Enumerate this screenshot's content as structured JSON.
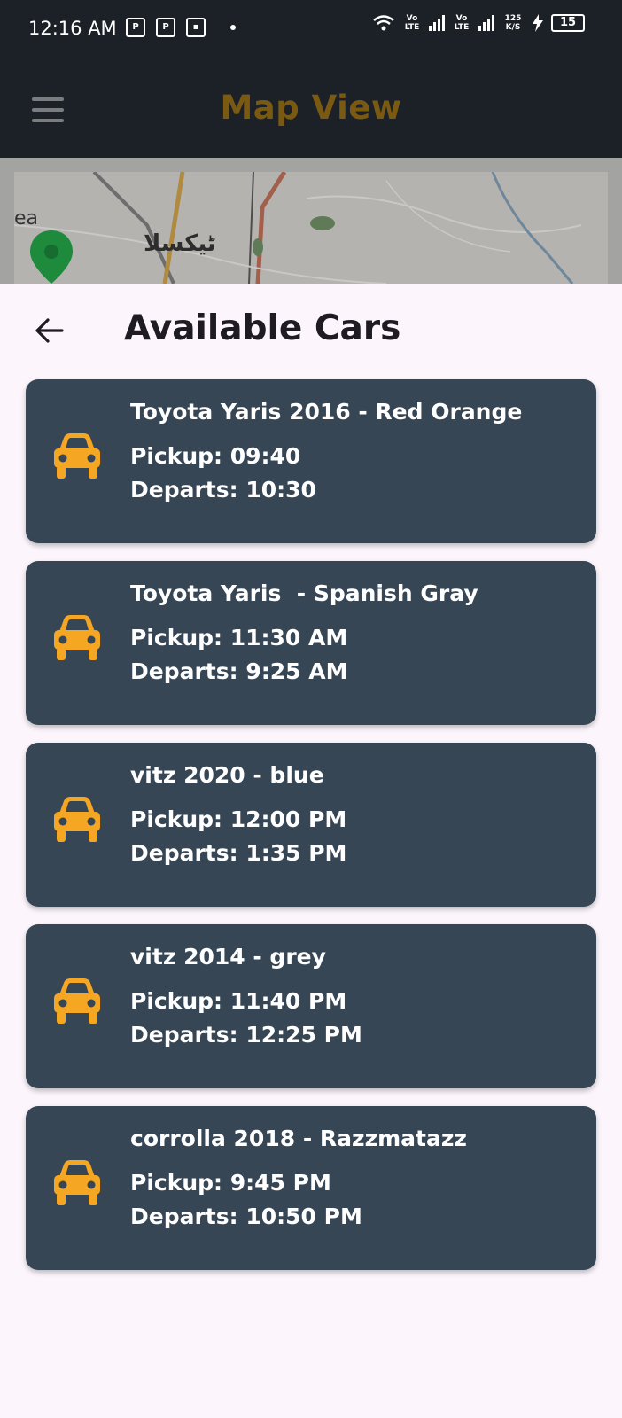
{
  "status_bar": {
    "time": "12:16 AM",
    "vo_lte_1": "Vo LTE",
    "vo_lte_2": "Vo LTE",
    "speed": "125 K/S",
    "battery": "15"
  },
  "app_bar": {
    "title": "Map View",
    "menu_icon": "hamburger-icon"
  },
  "map": {
    "label_urdu": "ٹیکسلا",
    "label_fragment": "ea"
  },
  "sheet": {
    "title": "Available Cars",
    "back_icon": "back-arrow-icon"
  },
  "colors": {
    "accent": "#f5a623",
    "card": "#374655",
    "app_bar": "#1c2127",
    "title_brown": "#7a5a12"
  },
  "cars": [
    {
      "name": "Toyota Yaris 2016 - Red Orange",
      "pickup": "Pickup: 09:40",
      "departs": "Departs: 10:30"
    },
    {
      "name": "Toyota Yaris  - Spanish Gray",
      "pickup": "Pickup: 11:30 AM",
      "departs": "Departs: 9:25 AM"
    },
    {
      "name": "vitz 2020 - blue",
      "pickup": "Pickup: 12:00 PM",
      "departs": "Departs: 1:35 PM"
    },
    {
      "name": "vitz 2014 - grey",
      "pickup": "Pickup: 11:40 PM",
      "departs": "Departs: 12:25 PM"
    },
    {
      "name": "corrolla 2018 - Razzmatazz",
      "pickup": "Pickup: 9:45 PM",
      "departs": "Departs: 10:50 PM"
    }
  ]
}
